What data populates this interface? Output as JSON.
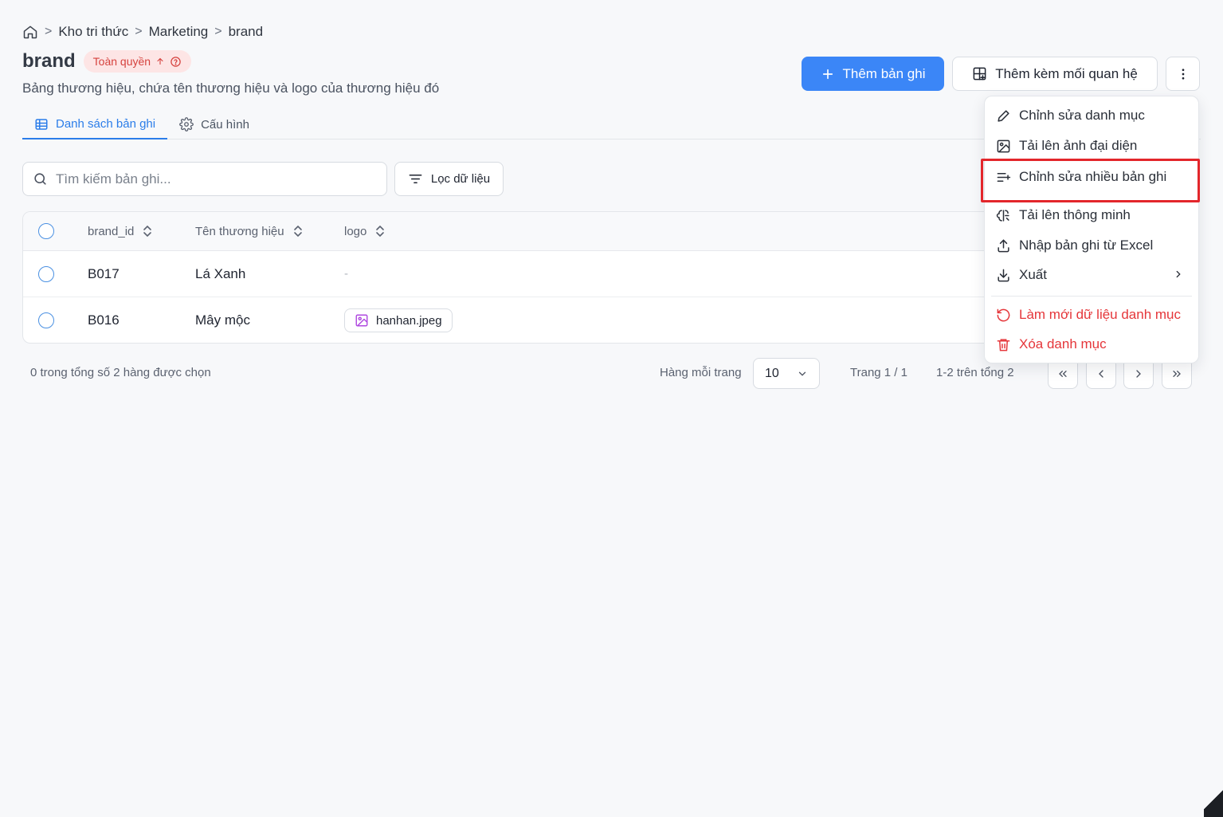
{
  "breadcrumb": {
    "items": [
      "Kho tri thức",
      "Marketing",
      "brand"
    ],
    "separator": ">"
  },
  "page": {
    "title": "brand",
    "permission_badge": "Toàn quyền",
    "description": "Bảng thương hiệu, chứa tên thương hiệu và logo của thương hiệu đó"
  },
  "tabs": [
    {
      "label": "Danh sách bản ghi",
      "icon": "table-icon",
      "active": true
    },
    {
      "label": "Cấu hình",
      "icon": "gear-icon",
      "active": false
    }
  ],
  "actions": {
    "add_record": "Thêm bản ghi",
    "add_with_relation": "Thêm kèm mối quan hệ"
  },
  "search": {
    "placeholder": "Tìm kiếm bản ghi...",
    "value": ""
  },
  "filter": {
    "label": "Lọc dữ liệu"
  },
  "table": {
    "columns": [
      "brand_id",
      "Tên thương hiệu",
      "logo"
    ],
    "rows": [
      {
        "brand_id": "B017",
        "name": "Lá Xanh",
        "logo": "-"
      },
      {
        "brand_id": "B016",
        "name": "Mây mộc",
        "logo": "hanhan.jpeg"
      }
    ]
  },
  "footer": {
    "selected_text": "0 trong tổng số 2 hàng được chọn",
    "rows_per_page_label": "Hàng mỗi trang",
    "rows_per_page_value": "10",
    "page_text": "Trang 1 / 1",
    "range_text": "1-2 trên tổng 2"
  },
  "menu": {
    "items": [
      {
        "label": "Chỉnh sửa danh mục",
        "icon": "pencil-icon",
        "danger": false
      },
      {
        "label": "Tải lên ảnh đại diện",
        "icon": "image-icon",
        "danger": false
      },
      {
        "label": "Chỉnh sửa nhiều bản ghi",
        "icon": "list-edit-icon",
        "danger": false,
        "highlighted": true
      },
      {
        "label": "Tải lên thông minh",
        "icon": "smart-upload-icon",
        "danger": false
      },
      {
        "label": "Nhập bản ghi từ Excel",
        "icon": "upload-icon",
        "danger": false
      },
      {
        "label": "Xuất",
        "icon": "download-icon",
        "danger": false,
        "submenu": true
      },
      {
        "label": "Làm mới dữ liệu danh mục",
        "icon": "refresh-icon",
        "danger": true
      },
      {
        "label": "Xóa danh mục",
        "icon": "trash-icon",
        "danger": true
      }
    ]
  },
  "colors": {
    "primary": "#3b86f7",
    "tab_active": "#2b7de9",
    "danger": "#e5363a",
    "badge_bg": "#fde5e5",
    "highlight_box": "#e3262b"
  }
}
